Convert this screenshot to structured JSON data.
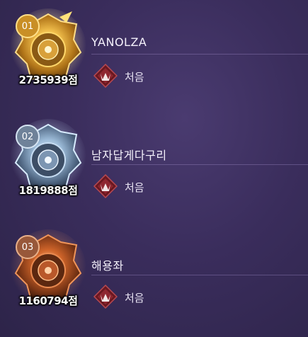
{
  "ranking": [
    {
      "rank": "01",
      "name": "YANOLZA",
      "score": "2735939점",
      "tier": "처음",
      "medal": "gold",
      "colors": {
        "rim": "#f5c14a",
        "core": "#c98a1c",
        "glow": "#ffe9a3",
        "badge": "#d9a030"
      }
    },
    {
      "rank": "02",
      "name": "남자답게다구리",
      "score": "1819888점",
      "tier": "처음",
      "medal": "silver",
      "colors": {
        "rim": "#b8d4f0",
        "core": "#5f7893",
        "glow": "#e4f2ff",
        "badge": "#7f93a8"
      }
    },
    {
      "rank": "03",
      "name": "해용좌",
      "score": "1160794점",
      "tier": "처음",
      "medal": "bronze",
      "colors": {
        "rim": "#e07a3a",
        "core": "#8a3f1a",
        "glow": "#ffb37a",
        "badge": "#a2603a"
      }
    }
  ]
}
